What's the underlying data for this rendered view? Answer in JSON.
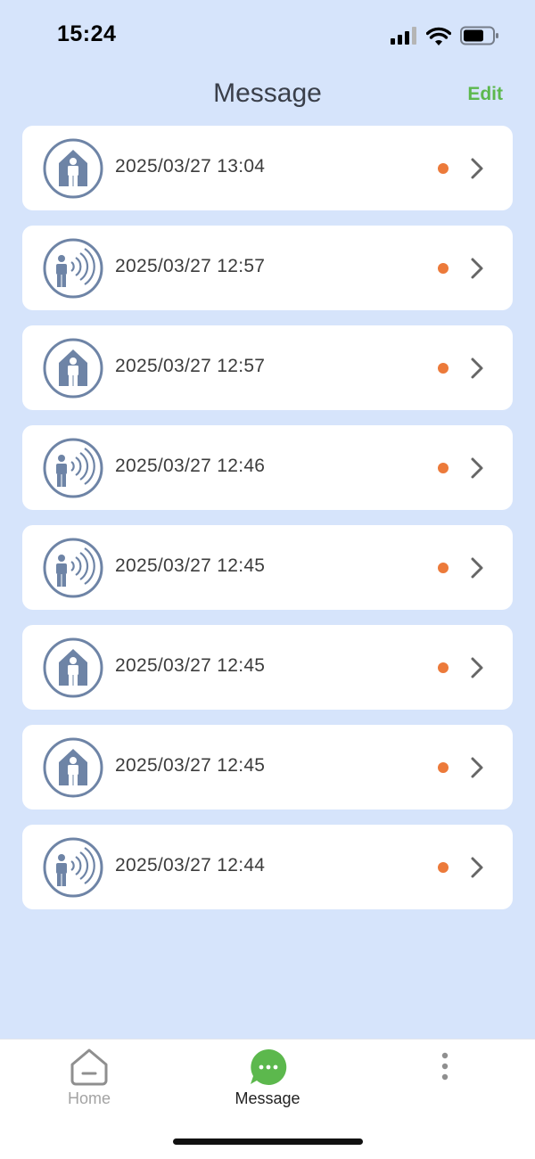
{
  "status_bar": {
    "time": "15:24",
    "icons": [
      "signal-icon",
      "wifi-icon",
      "battery-icon"
    ]
  },
  "header": {
    "title": "Message",
    "edit_label": "Edit"
  },
  "messages": [
    {
      "type": "home-person-icon",
      "time": "2025/03/27 13:04",
      "unread": true
    },
    {
      "type": "person-sensor-icon",
      "time": "2025/03/27 12:57",
      "unread": true
    },
    {
      "type": "home-person-icon",
      "time": "2025/03/27 12:57",
      "unread": true
    },
    {
      "type": "person-sensor-icon",
      "time": "2025/03/27 12:46",
      "unread": true
    },
    {
      "type": "person-sensor-icon",
      "time": "2025/03/27 12:45",
      "unread": true
    },
    {
      "type": "home-person-icon",
      "time": "2025/03/27 12:45",
      "unread": true
    },
    {
      "type": "home-person-icon",
      "time": "2025/03/27 12:45",
      "unread": true
    },
    {
      "type": "person-sensor-icon",
      "time": "2025/03/27 12:44",
      "unread": true
    }
  ],
  "tab_bar": {
    "tabs": [
      {
        "label": "Home",
        "icon": "home-icon",
        "active": false
      },
      {
        "label": "Message",
        "icon": "message-icon",
        "active": true
      },
      {
        "label": "",
        "icon": "more-vertical-icon",
        "active": false
      }
    ]
  },
  "colors": {
    "background": "#d6e4fb",
    "accent_green": "#5cb84d",
    "unread_dot": "#ec7a3a",
    "icon_blue": "#6e84a6"
  }
}
